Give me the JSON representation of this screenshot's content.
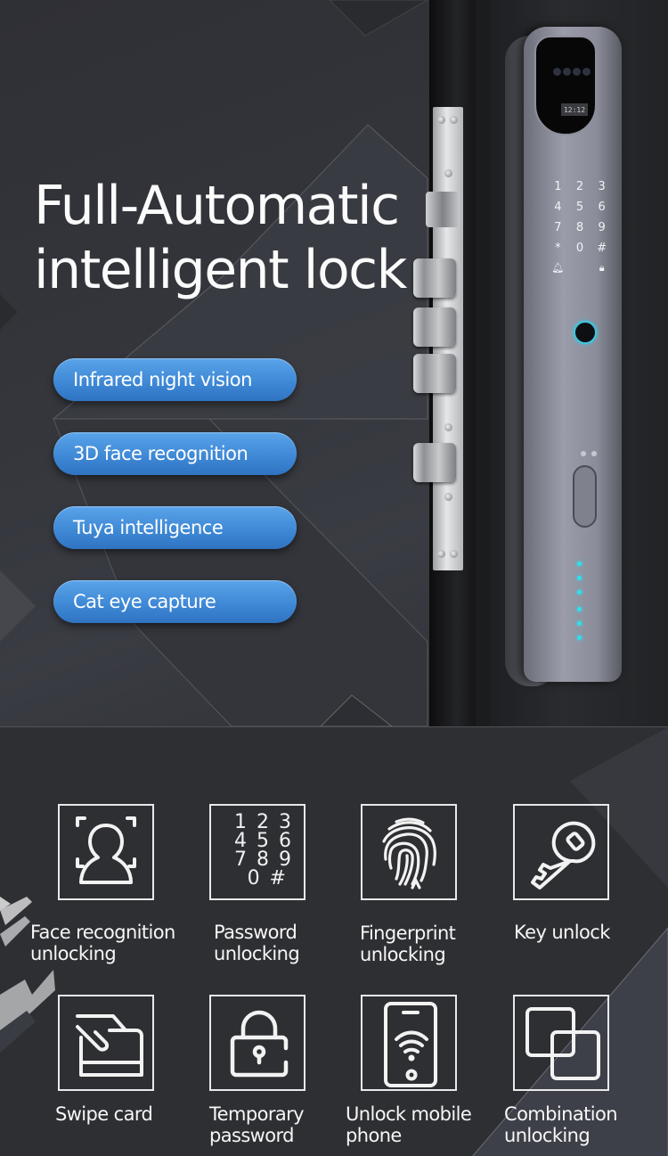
{
  "hero": {
    "title_line1": "Full-Automatic",
    "title_line2": "intelligent lock",
    "highlights": [
      "Infrared night vision",
      "3D face recognition",
      "Tuya intelligence",
      "Cat eye capture"
    ],
    "accent_color": "#3f89d6"
  },
  "lock_product": {
    "display_time": "12:12",
    "keypad": [
      "1",
      "2",
      "3",
      "4",
      "5",
      "6",
      "7",
      "8",
      "9",
      "*",
      "0",
      "#"
    ],
    "led_color": "#2de0f0"
  },
  "features": {
    "items": [
      {
        "label": "Face recognition\nunlocking",
        "icon": "face-recognition-icon"
      },
      {
        "label": "Password\nunlocking",
        "icon": "keypad-icon",
        "digits": "1 2 3\n4 5 6\n7 8 9\n0 #"
      },
      {
        "label": "Fingerprint\nunlocking",
        "icon": "fingerprint-icon"
      },
      {
        "label": "Key unlock",
        "icon": "key-icon"
      },
      {
        "label": "Swipe card",
        "icon": "swipe-card-icon"
      },
      {
        "label": "Temporary\npassword",
        "icon": "padlock-icon"
      },
      {
        "label": "Unlock mobile\nphone",
        "icon": "mobile-phone-wifi-icon"
      },
      {
        "label": "Combination\nunlocking",
        "icon": "combination-squares-icon"
      }
    ]
  }
}
